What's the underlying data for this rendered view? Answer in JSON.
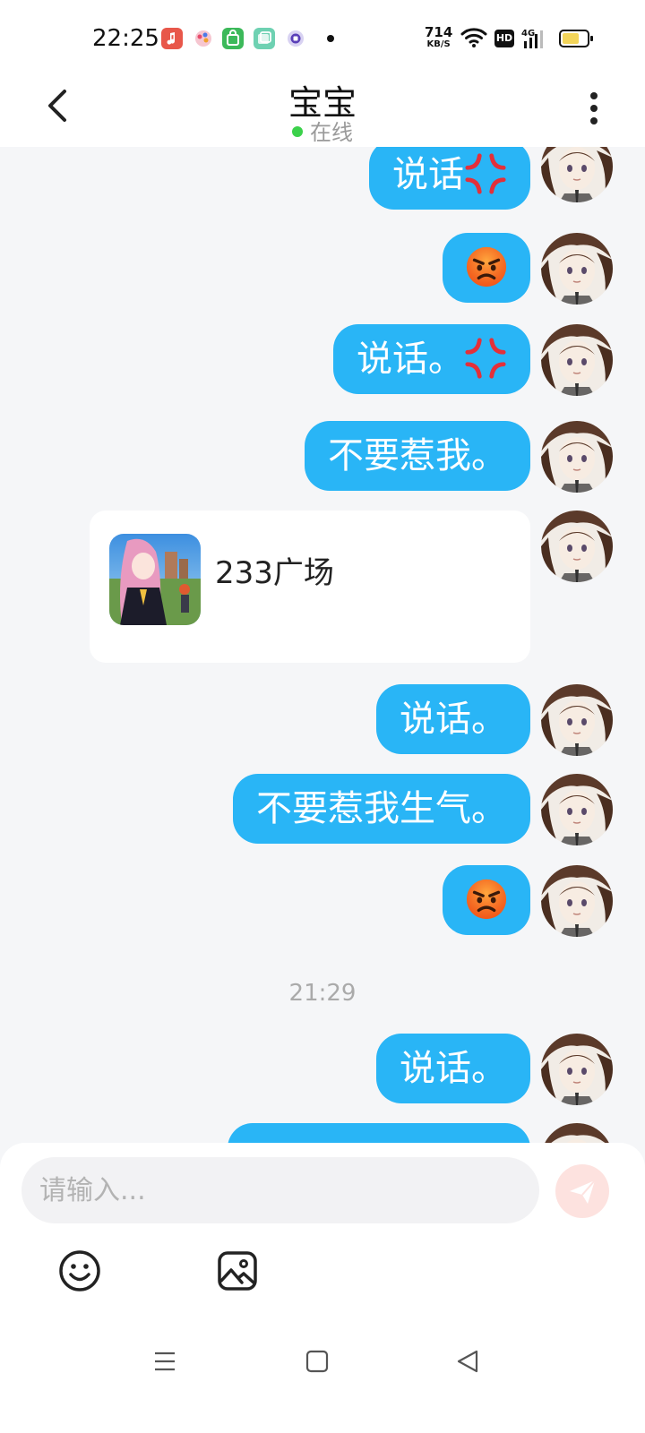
{
  "status_bar": {
    "time": "22:25",
    "speed_value": "714",
    "speed_unit": "KB/S",
    "hd_label": "HD",
    "network_label": "4G",
    "app_icons": [
      "music-app-icon",
      "paint-app-icon",
      "store-app-icon",
      "gallery-app-icon",
      "browser-app-icon"
    ]
  },
  "header": {
    "title": "宝宝",
    "status": "在线",
    "status_color": "#3bd14b"
  },
  "messages": [
    {
      "type": "text",
      "text": "说话",
      "emoji": "anger-symbol-icon"
    },
    {
      "type": "emoji",
      "emoji": "angry-face-icon"
    },
    {
      "type": "text",
      "text": "说话。",
      "emoji": "anger-symbol-icon"
    },
    {
      "type": "text",
      "text": "不要惹我。"
    },
    {
      "type": "card",
      "title": "233广场"
    },
    {
      "type": "text",
      "text": "说话。"
    },
    {
      "type": "text",
      "text": "不要惹我生气。"
    },
    {
      "type": "emoji",
      "emoji": "angry-face-icon"
    },
    {
      "type": "time",
      "text": "21:29"
    },
    {
      "type": "text",
      "text": "说话。"
    }
  ],
  "input": {
    "placeholder": "请输入..."
  },
  "colors": {
    "bubble": "#29b5f6",
    "background": "#f5f6f8",
    "send_button": "#fde2df"
  }
}
